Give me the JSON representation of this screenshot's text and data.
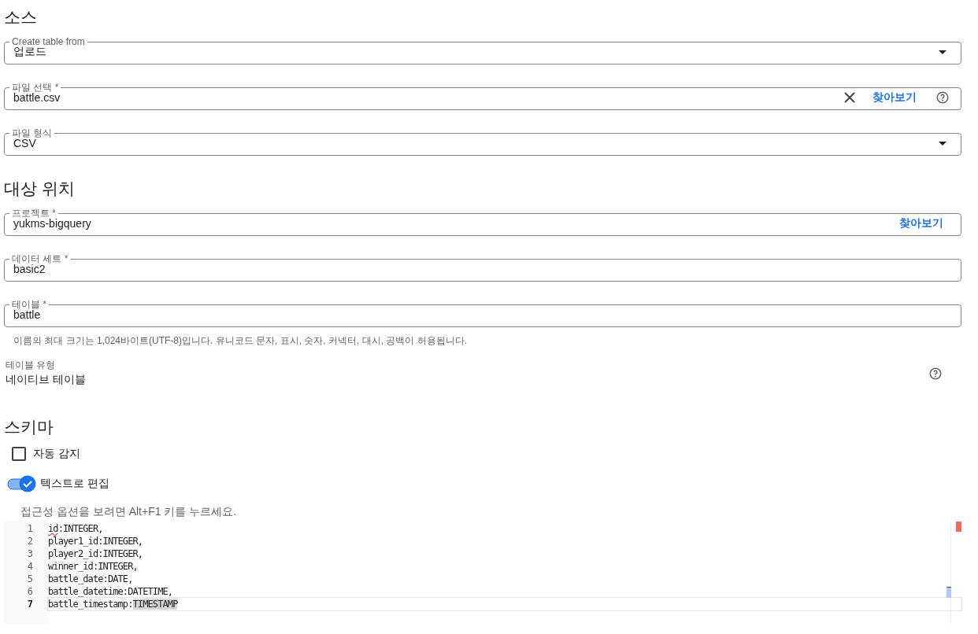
{
  "sections": [
    {
      "title": "소스",
      "fields": [
        {
          "kind": "select",
          "label": "Create table from",
          "value": "업로드"
        },
        {
          "kind": "text",
          "label": "파일 선택 *",
          "value": "battle.csv",
          "clear": true,
          "browse": "찾아보기",
          "help": true
        },
        {
          "kind": "select",
          "label": "파일 형식",
          "value": "CSV"
        }
      ]
    },
    {
      "title": "대상 위치",
      "fields": [
        {
          "kind": "text",
          "label": "프로젝트 *",
          "value": "yukms-bigquery",
          "browse": "찾아보기"
        },
        {
          "kind": "text",
          "label": "데이터 세트 *",
          "value": "basic2"
        },
        {
          "kind": "text",
          "label": "테이블 *",
          "value": "battle",
          "hint": "이름의 최대 크기는 1,024바이트(UTF-8)입니다. 유니코드 문자, 표시, 숫자, 커넥터, 대시, 공백이 허용됩니다."
        }
      ],
      "info": {
        "label": "테이블 유형",
        "value": "네이티브 테이블",
        "help": true
      }
    },
    {
      "title": "스키마",
      "options": [
        {
          "kind": "checkbox",
          "label": "자동 감지",
          "checked": false
        },
        {
          "kind": "toggle",
          "label": "텍스트로 편집",
          "on": true
        }
      ],
      "editor": {
        "hint": "접근성 옵션을 보려면 Alt+F1 키를 누르세요.",
        "lines": [
          {
            "number": "1",
            "current": false,
            "segments": [
              {
                "text": "id",
                "misspelled": true
              },
              {
                "text": ":INTEGER,"
              }
            ]
          },
          {
            "number": "2",
            "current": false,
            "segments": [
              {
                "text": "player1_id:INTEGER,"
              }
            ]
          },
          {
            "number": "3",
            "current": false,
            "segments": [
              {
                "text": "player2_id:INTEGER,"
              }
            ]
          },
          {
            "number": "4",
            "current": false,
            "segments": [
              {
                "text": "winner_id:INTEGER,"
              }
            ]
          },
          {
            "number": "5",
            "current": false,
            "segments": [
              {
                "text": "battle_date:DATE,"
              }
            ]
          },
          {
            "number": "6",
            "current": false,
            "segments": [
              {
                "text": "battle_datetime:DATETIME,"
              }
            ]
          },
          {
            "number": "7",
            "current": true,
            "segments": [
              {
                "text": "battle_timestamp:"
              },
              {
                "text": "TIMESTAMP",
                "selected": true
              }
            ]
          }
        ]
      }
    }
  ]
}
